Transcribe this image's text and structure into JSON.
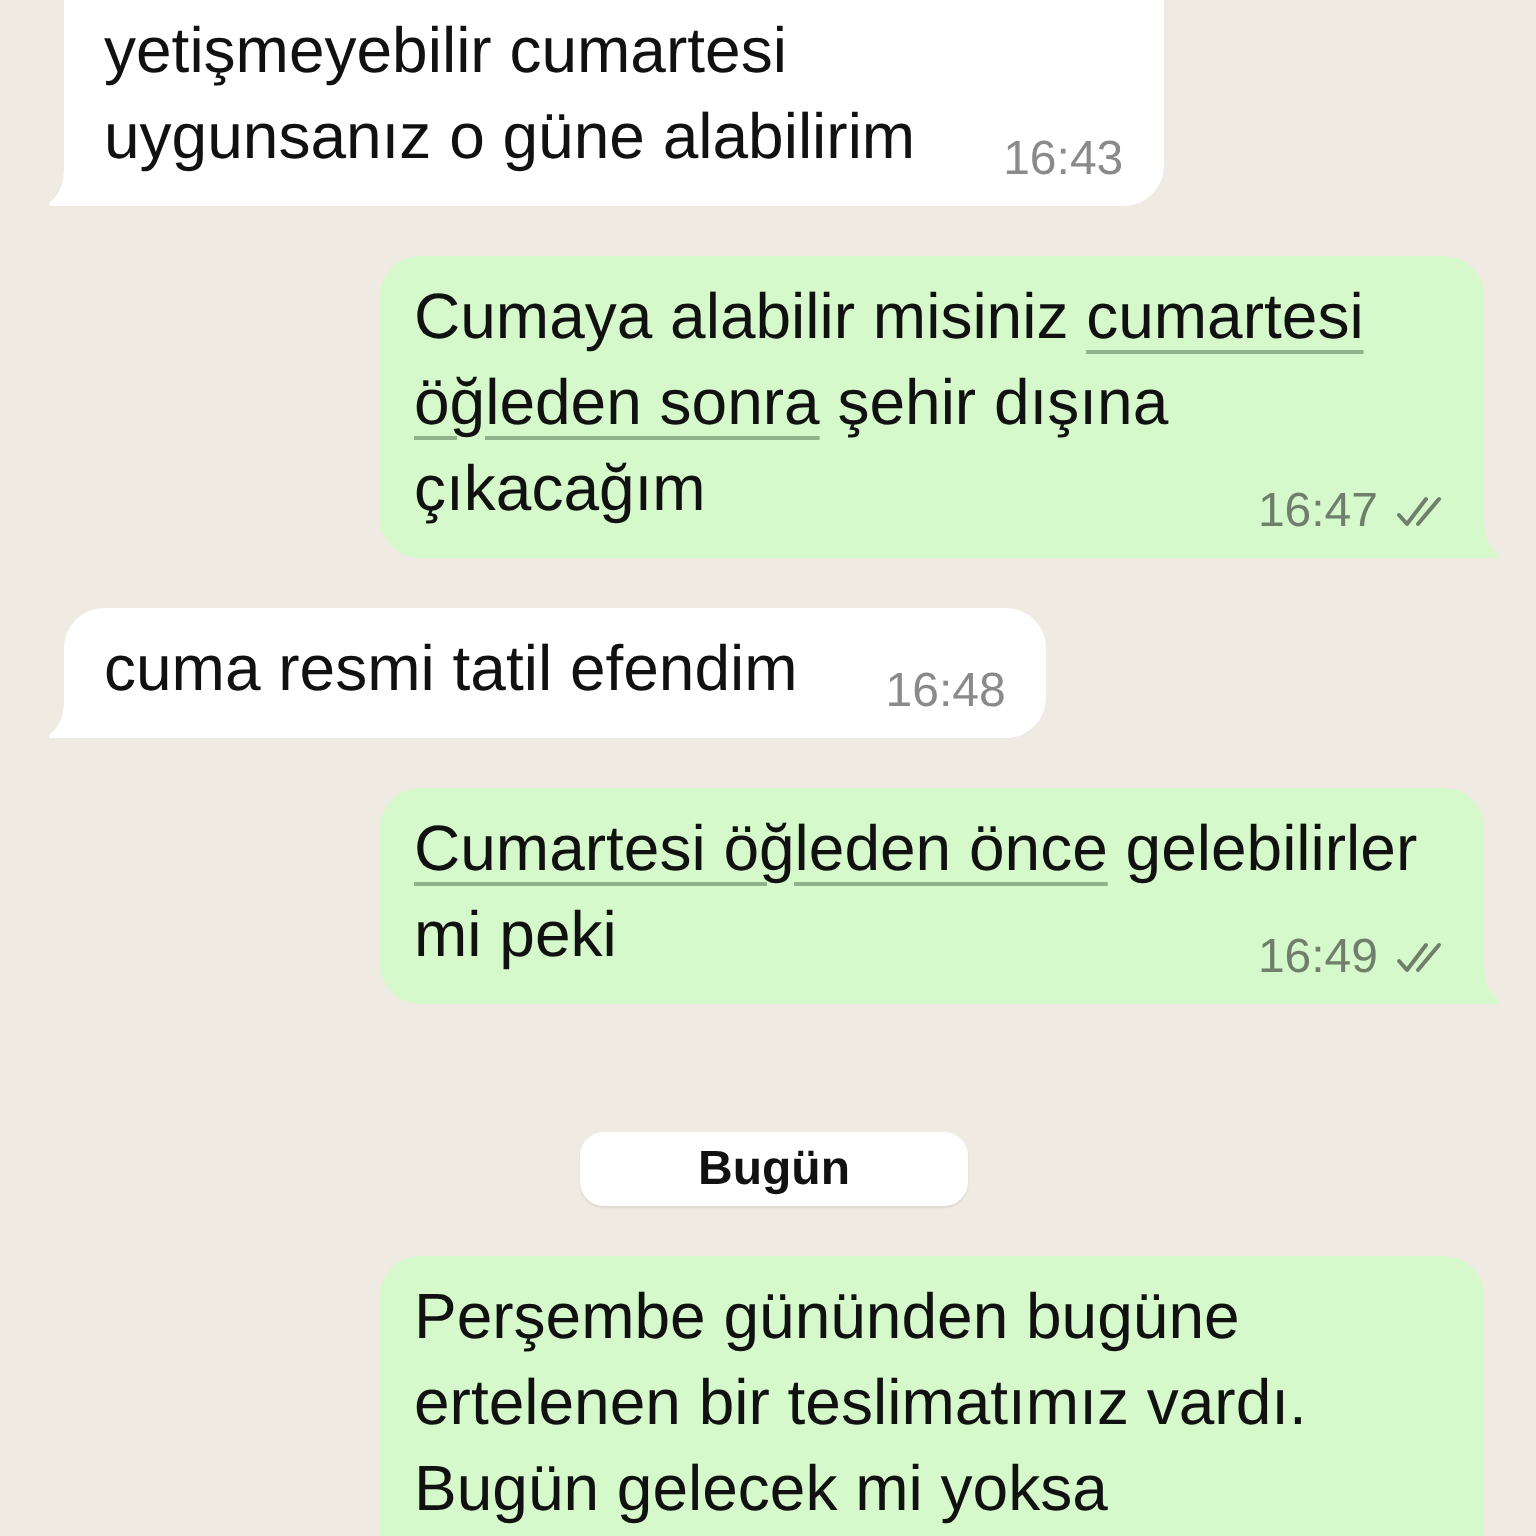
{
  "messages": [
    {
      "kind": "incoming",
      "tail": true,
      "lines": [
        [
          {
            "kind": "text",
            "text": "yetişmeyebilir cumartesi"
          }
        ],
        [
          {
            "kind": "text",
            "text": "uygunsanız o güne alabilirim"
          }
        ]
      ],
      "time": "16:43"
    },
    {
      "kind": "outgoing",
      "tail": true,
      "lines": [
        [
          {
            "kind": "text",
            "text": "Cumaya alabilir misiniz "
          },
          {
            "kind": "link",
            "text": "cumartesi"
          }
        ],
        [
          {
            "kind": "link",
            "text": "öğleden sonra"
          },
          {
            "kind": "text",
            "text": " şehir dışına"
          }
        ],
        [
          {
            "kind": "text",
            "text": "çıkacağım"
          }
        ]
      ],
      "time": "16:47",
      "delivered": true,
      "read": false
    },
    {
      "kind": "incoming",
      "tail": true,
      "lines": [
        [
          {
            "kind": "text",
            "text": "cuma resmi tatil efendim"
          }
        ]
      ],
      "time": "16:48"
    },
    {
      "kind": "outgoing",
      "tail": true,
      "lines": [
        [
          {
            "kind": "link",
            "text": "Cumartesi öğleden önce"
          },
          {
            "kind": "text",
            "text": " gelebilirler"
          }
        ],
        [
          {
            "kind": "text",
            "text": "mi peki"
          }
        ]
      ],
      "time": "16:49",
      "delivered": true,
      "read": false
    },
    {
      "kind": "date",
      "label": "Bugün"
    },
    {
      "kind": "outgoing",
      "tail": false,
      "lines": [
        [
          {
            "kind": "text",
            "text": "Perşembe gününden bugüne"
          }
        ],
        [
          {
            "kind": "text",
            "text": "ertelenen bir teslimatımız vardı."
          }
        ],
        [
          {
            "kind": "text",
            "text": "Bugün gelecek mi yoksa"
          }
        ]
      ]
    }
  ]
}
